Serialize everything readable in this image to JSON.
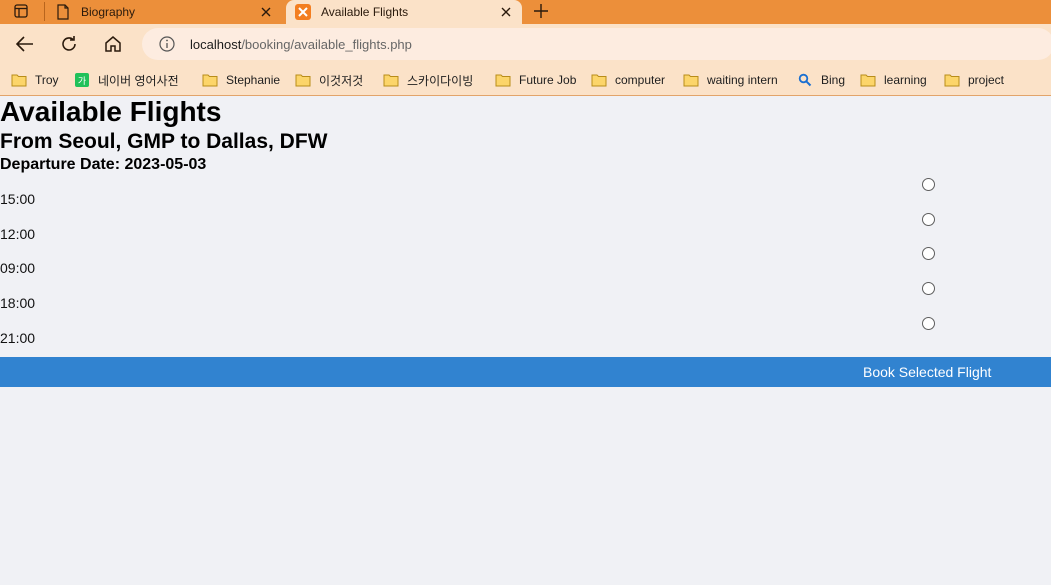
{
  "browser": {
    "tabs": [
      {
        "title": "Biography",
        "active": false
      },
      {
        "title": "Available Flights",
        "active": true
      }
    ],
    "address": {
      "host": "localhost",
      "path": "/booking/available_flights.php"
    },
    "bookmarks": [
      {
        "label": "Troy",
        "icon": "folder-icon"
      },
      {
        "label": "네이버 영어사전",
        "icon": "naver-dictionary-icon"
      },
      {
        "label": "Stephanie",
        "icon": "folder-icon"
      },
      {
        "label": "이것저것",
        "icon": "folder-icon"
      },
      {
        "label": "스카이다이빙",
        "icon": "folder-icon"
      },
      {
        "label": "Future Job",
        "icon": "folder-icon"
      },
      {
        "label": "computer",
        "icon": "folder-icon"
      },
      {
        "label": "waiting intern",
        "icon": "folder-icon"
      },
      {
        "label": "Bing",
        "icon": "search-icon"
      },
      {
        "label": "learning",
        "icon": "folder-icon"
      },
      {
        "label": "project",
        "icon": "folder-icon"
      }
    ],
    "colors": {
      "tabstrip": "#ec8f3a",
      "toolbar": "#fbe2c8"
    }
  },
  "page": {
    "title": "Available Flights",
    "route": "From Seoul, GMP to Dallas, DFW",
    "departure": "Departure Date: 2023-05-03",
    "flights": [
      {
        "time": "15:00"
      },
      {
        "time": "12:00"
      },
      {
        "time": "09:00"
      },
      {
        "time": "18:00"
      },
      {
        "time": "21:00"
      }
    ],
    "book_button": "Book Selected Flight",
    "colors": {
      "button": "#3183d0",
      "background": "#f0f1f5"
    }
  }
}
